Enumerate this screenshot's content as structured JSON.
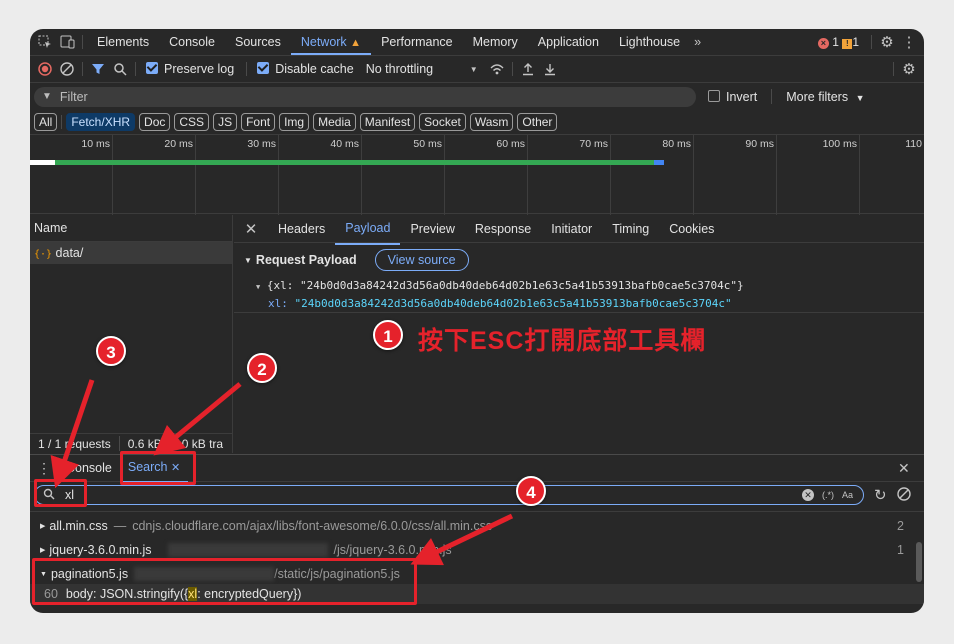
{
  "toolbar": {
    "tabs": [
      "Elements",
      "Console",
      "Sources",
      "Network",
      "Performance",
      "Memory",
      "Application",
      "Lighthouse"
    ],
    "active_tab": "Network",
    "more": "»",
    "errors": "1",
    "warnings": "1"
  },
  "network_bar": {
    "preserve_log": "Preserve log",
    "disable_cache": "Disable cache",
    "throttling": "No throttling"
  },
  "filter": {
    "placeholder": "Filter",
    "invert": "Invert",
    "more_filters": "More filters"
  },
  "types": [
    "All",
    "Fetch/XHR",
    "Doc",
    "CSS",
    "JS",
    "Font",
    "Img",
    "Media",
    "Manifest",
    "Socket",
    "Wasm",
    "Other"
  ],
  "timeline": {
    "ticks": [
      "10 ms",
      "20 ms",
      "30 ms",
      "40 ms",
      "50 ms",
      "60 ms",
      "70 ms",
      "80 ms",
      "90 ms",
      "100 ms",
      "110"
    ]
  },
  "requests": {
    "header": "Name",
    "items": [
      {
        "name": "data/"
      }
    ],
    "status": "1 / 1 requests",
    "size": "0.6 kB / 2.0 kB tra"
  },
  "detail": {
    "tabs": [
      "Headers",
      "Payload",
      "Preview",
      "Response",
      "Initiator",
      "Timing",
      "Cookies"
    ],
    "active": "Payload",
    "section": "Request Payload",
    "view_source": "View source",
    "summary": "{xl: \"24b0d0d3a84242d3d56a0db40deb64d02b1e63c5a41b53913bafb0cae5c3704c\"}",
    "key": "xl:",
    "value": "\"24b0d0d3a84242d3d56a0db40deb64d02b1e63c5a41b53913bafb0cae5c3704c\""
  },
  "annotation": {
    "text": "按下ESC打開底部工具欄",
    "badges": [
      "1",
      "2",
      "3",
      "4"
    ]
  },
  "drawer": {
    "tabs": [
      "Console",
      "Search"
    ],
    "active": "Search",
    "query": "xl",
    "regex": "(.*)",
    "case": "Aa"
  },
  "results": [
    {
      "file": "all.min.css",
      "path": "cdnjs.cloudflare.com/ajax/libs/font-awesome/6.0.0/css/all.min.css",
      "count": "2"
    },
    {
      "file": "jquery-3.6.0.min.js",
      "path": "/js/jquery-3.6.0.min.js",
      "count": "1"
    },
    {
      "file": "pagination5.js",
      "path": "/static/js/pagination5.js",
      "count": ""
    }
  ],
  "match": {
    "line": "60",
    "pre": "body: JSON.stringify({",
    "hit": "xl",
    "post": ": encryptedQuery})"
  }
}
